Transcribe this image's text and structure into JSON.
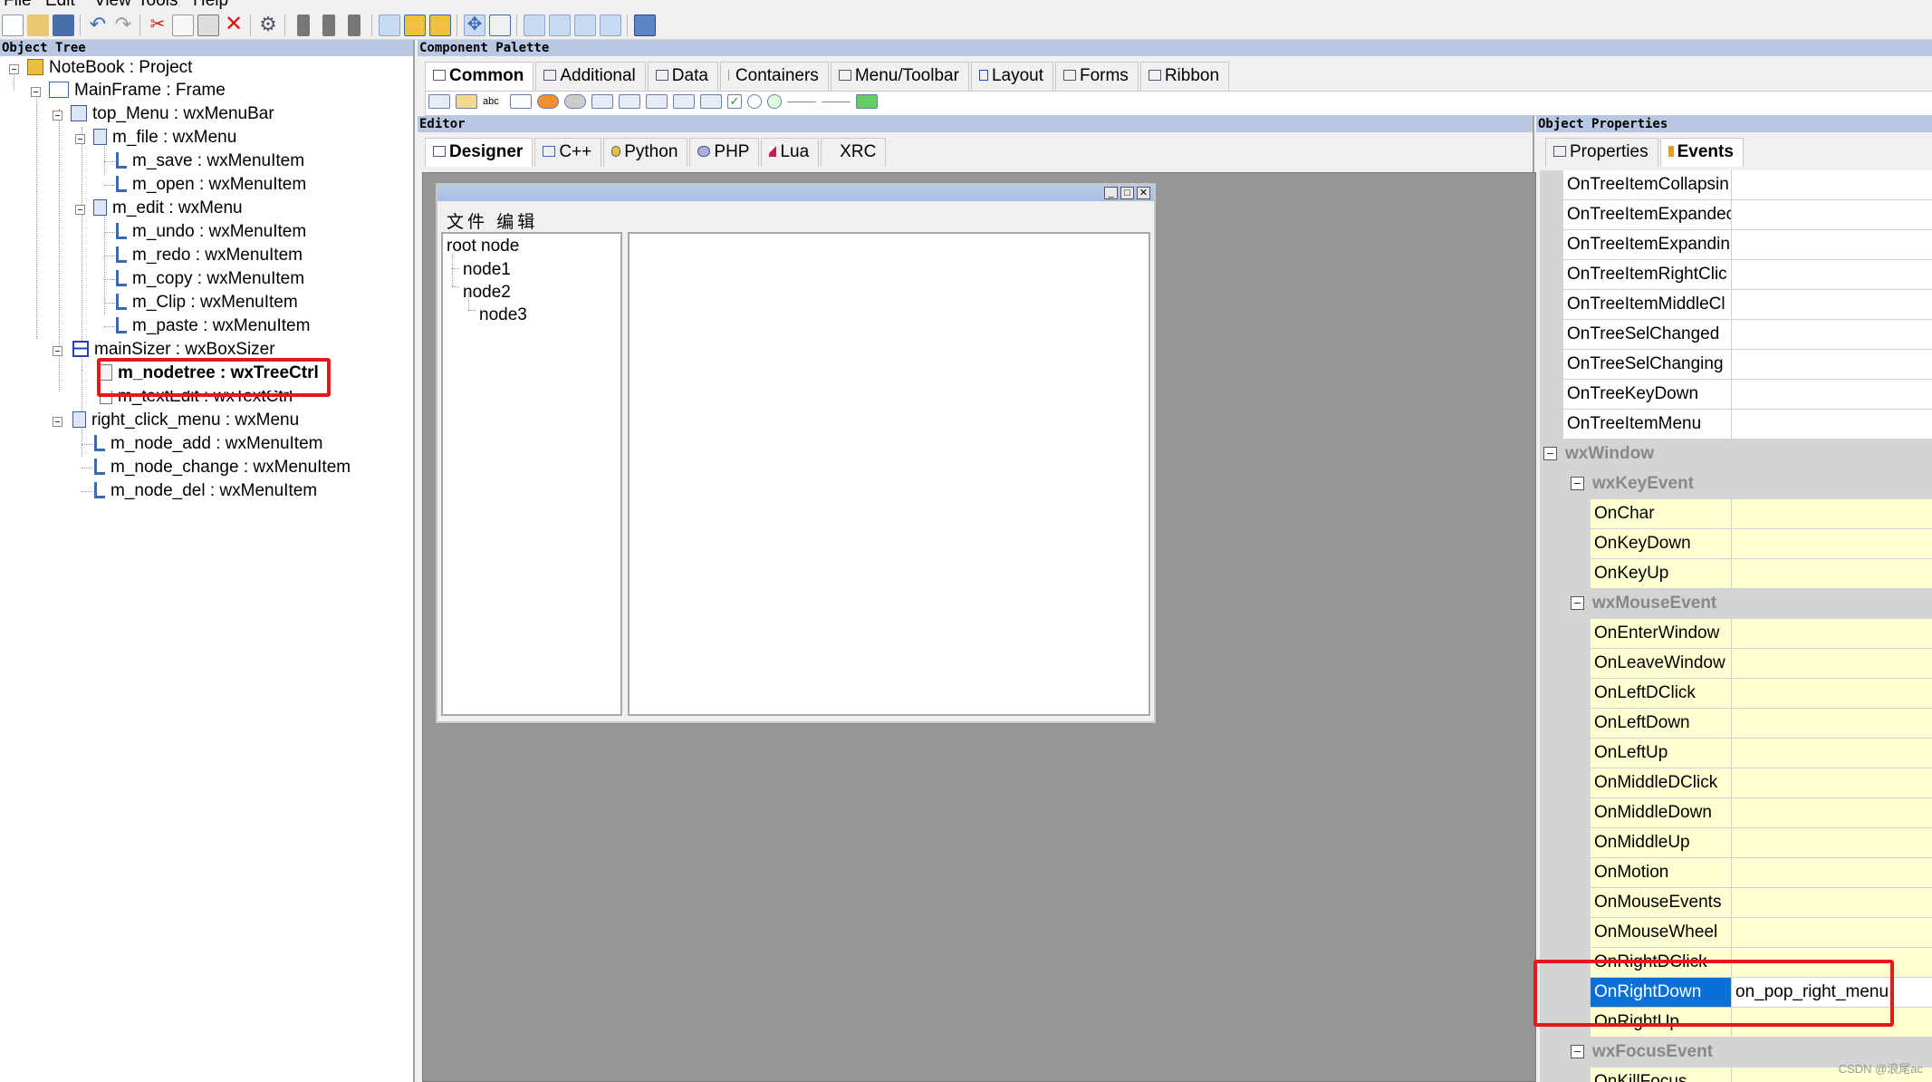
{
  "menubar": {
    "items": [
      "File",
      "Edit",
      "View",
      "Tools",
      "Help"
    ]
  },
  "object_tree": {
    "title": "Object Tree",
    "nodes": [
      {
        "label": "NoteBook : Project"
      },
      {
        "label": "MainFrame : Frame"
      },
      {
        "label": "top_Menu : wxMenuBar"
      },
      {
        "label": "m_file : wxMenu"
      },
      {
        "label": "m_save : wxMenuItem"
      },
      {
        "label": "m_open : wxMenuItem"
      },
      {
        "label": "m_edit : wxMenu"
      },
      {
        "label": "m_undo : wxMenuItem"
      },
      {
        "label": "m_redo : wxMenuItem"
      },
      {
        "label": "m_copy : wxMenuItem"
      },
      {
        "label": "m_Clip : wxMenuItem"
      },
      {
        "label": "m_paste : wxMenuItem"
      },
      {
        "label": "mainSizer : wxBoxSizer"
      },
      {
        "label": "m_nodetree : wxTreeCtrl"
      },
      {
        "label": "m_textEdit : wxTextCtrl"
      },
      {
        "label": "right_click_menu : wxMenu"
      },
      {
        "label": "m_node_add : wxMenuItem"
      },
      {
        "label": "m_node_change : wxMenuItem"
      },
      {
        "label": "m_node_del : wxMenuItem"
      }
    ]
  },
  "palette": {
    "title": "Component Palette",
    "tabs": [
      "Common",
      "Additional",
      "Data",
      "Containers",
      "Menu/Toolbar",
      "Layout",
      "Forms",
      "Ribbon"
    ]
  },
  "editor": {
    "title": "Editor",
    "tabs": [
      "Designer",
      "C++",
      "Python",
      "PHP",
      "Lua",
      "XRC"
    ],
    "frame_menu": "文件 编辑",
    "tree_nodes": [
      "root node",
      "node1",
      "node2",
      "node3"
    ]
  },
  "properties": {
    "title": "Object Properties",
    "tabs": [
      "Properties",
      "Events"
    ],
    "tree_events": [
      "OnTreeItemCollapsin",
      "OnTreeItemExpandec",
      "OnTreeItemExpandin",
      "OnTreeItemRightClic",
      "OnTreeItemMiddleCl",
      "OnTreeSelChanged",
      "OnTreeSelChanging",
      "OnTreeKeyDown",
      "OnTreeItemMenu"
    ],
    "cat_window": "wxWindow",
    "cat_key": "wxKeyEvent",
    "key_events": [
      "OnChar",
      "OnKeyDown",
      "OnKeyUp"
    ],
    "cat_mouse": "wxMouseEvent",
    "mouse_events": [
      "OnEnterWindow",
      "OnLeaveWindow",
      "OnLeftDClick",
      "OnLeftDown",
      "OnLeftUp",
      "OnMiddleDClick",
      "OnMiddleDown",
      "OnMiddleUp",
      "OnMotion",
      "OnMouseEvents",
      "OnMouseWheel",
      "OnRightDClick"
    ],
    "selected_event": "OnRightDown",
    "selected_value": "on_pop_right_menu",
    "after_events": [
      "OnRightUp"
    ],
    "cat_focus": "wxFocusEvent",
    "focus_events": [
      "OnKillFocus"
    ]
  },
  "watermark": "CSDN @浪尾ac",
  "colors": {
    "highlight": "#e81818",
    "selected": "#0a6fd6",
    "event_bg": "#ffffd2",
    "title_bar": "#b8c8e2"
  }
}
